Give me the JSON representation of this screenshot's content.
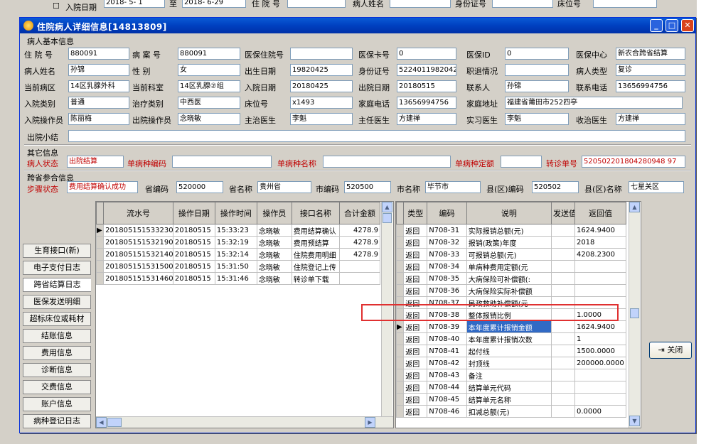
{
  "background": {
    "checkbox_label": "入院日期",
    "date_from": "2018- 5- 1",
    "to_label": "至",
    "date_to": "2018- 6-29",
    "admission_no_label": "住 院 号",
    "patient_name_label": "病人姓名",
    "id_label": "身份证号",
    "bed_label": "床位号"
  },
  "window": {
    "title": "住院病人详细信息[14813809]"
  },
  "sections": {
    "patient": "病人基本信息",
    "other": "其它信息",
    "cross": "跨省参合信息"
  },
  "fields": [
    {
      "label": "住 院 号",
      "value": "880091"
    },
    {
      "label": "病 案 号",
      "value": "880091"
    },
    {
      "label": "医保住院号",
      "value": ""
    },
    {
      "label": "医保卡号",
      "value": "0"
    },
    {
      "label": "医保ID",
      "value": "0"
    },
    {
      "label": "医保中心",
      "value": "新农合跨省结算"
    },
    {
      "label": "病人姓名",
      "value": "孙锦"
    },
    {
      "label": "性    别",
      "value": "女"
    },
    {
      "label": "出生日期",
      "value": "19820425"
    },
    {
      "label": "身份证号",
      "value": "52240119820425"
    },
    {
      "label": "职退情况",
      "value": ""
    },
    {
      "label": "病人类型",
      "value": "复诊"
    },
    {
      "label": "当前病区",
      "value": "14区乳腺外科"
    },
    {
      "label": "当前科室",
      "value": "14区乳腺②组"
    },
    {
      "label": "入院日期",
      "value": "20180425"
    },
    {
      "label": "出院日期",
      "value": "20180515"
    },
    {
      "label": "联系人",
      "value": "孙锦"
    },
    {
      "label": "联系电话",
      "value": "13656994756"
    },
    {
      "label": "入院类别",
      "value": "普通"
    },
    {
      "label": "治疗类别",
      "value": "中西医"
    },
    {
      "label": "床位号",
      "value": "x1493"
    },
    {
      "label": "家庭电话",
      "value": "13656994756"
    },
    {
      "label": "家庭地址",
      "value": "福建省莆田市252四亭"
    },
    {
      "label": "入院操作员",
      "value": "陈丽梅"
    },
    {
      "label": "出院操作员",
      "value": "念晓敏"
    },
    {
      "label": "主治医生",
      "value": "李魁"
    },
    {
      "label": "主任医生",
      "value": "方建禅"
    },
    {
      "label": "实习医生",
      "value": "李魁"
    },
    {
      "label": "收治医生",
      "value": "方建禅"
    }
  ],
  "discharge_summary": {
    "label": "出院小结",
    "value": ""
  },
  "other": {
    "status_label": "病人状态",
    "status_value": "出院结算",
    "disease_code_label": "单病种编码",
    "disease_code_value": "",
    "disease_name_label": "单病种名称",
    "disease_name_value": "",
    "disease_fixed_label": "单病种定额",
    "disease_fixed_value": "",
    "referral_label": "转诊单号",
    "referral_value": "520502201804280948 97"
  },
  "cross": {
    "step_label": "步骤状态",
    "step_value": "费用结算确认成功",
    "prov_code_label": "省编码",
    "prov_code_value": "520000",
    "prov_name_label": "省名称",
    "prov_name_value": "贵州省",
    "city_code_label": "市编码",
    "city_code_value": "520500",
    "city_name_label": "市名称",
    "city_name_value": "毕节市",
    "county_code_label": "县(区)编码",
    "county_code_value": "520502",
    "county_name_label": "县(区)名称",
    "county_name_value": "七星关区"
  },
  "tabs": [
    "生育接口(新)",
    "电子支付日志",
    "跨省结算日志",
    "医保发送明细",
    "超标床位或耗材",
    "结账信息",
    "费用信息",
    "诊断信息",
    "交费信息",
    "账户信息",
    "病种登记日志"
  ],
  "active_tab": "跨省结算日志",
  "log_table": {
    "headers": [
      "流水号",
      "操作日期",
      "操作时间",
      "操作员",
      "接口名称",
      "合计金额"
    ],
    "rows": [
      [
        "20180515153323030",
        "20180515",
        "15:33:23",
        "念晓敏",
        "费用结算确认",
        "4278.9"
      ],
      [
        "20180515153219030",
        "20180515",
        "15:32:19",
        "念晓敏",
        "费用预结算",
        "4278.9"
      ],
      [
        "20180515153214030",
        "20180515",
        "15:32:14",
        "念晓敏",
        "住院费用明细",
        "4278.9"
      ],
      [
        "20180515153150030",
        "20180515",
        "15:31:50",
        "念晓敏",
        "住院登记上传",
        ""
      ],
      [
        "20180515153146030",
        "20180515",
        "15:31:46",
        "念晓敏",
        "转诊单下载",
        ""
      ]
    ]
  },
  "detail_table": {
    "headers": [
      "类型",
      "编码",
      "说明",
      "发送值",
      "返回值"
    ],
    "rows": [
      [
        "返回",
        "N708-31",
        "实际报销总额(元)",
        "",
        "1624.9400"
      ],
      [
        "返回",
        "N708-32",
        "报销(政策)年度",
        "",
        "2018"
      ],
      [
        "返回",
        "N708-33",
        "可报销总额(元)",
        "",
        "4208.2300"
      ],
      [
        "返回",
        "N708-34",
        "单病种费用定额(元",
        "",
        ""
      ],
      [
        "返回",
        "N708-35",
        "大病保险可补偿额(:",
        "",
        ""
      ],
      [
        "返回",
        "N708-36",
        "大病保险实际补偿额",
        "",
        ""
      ],
      [
        "返回",
        "N708-37",
        "民政救助补偿额(元",
        "",
        ""
      ],
      [
        "返回",
        "N708-38",
        "整体报销比例",
        "",
        "1.0000"
      ],
      [
        "返回",
        "N708-39",
        "本年度累计报销金额",
        "",
        "1624.9400"
      ],
      [
        "返回",
        "N708-40",
        "本年度累计报销次数",
        "",
        "1"
      ],
      [
        "返回",
        "N708-41",
        "起付线",
        "",
        "1500.0000"
      ],
      [
        "返回",
        "N708-42",
        "封顶线",
        "",
        "200000.0000"
      ],
      [
        "返回",
        "N708-43",
        "备注",
        "",
        ""
      ],
      [
        "返回",
        "N708-44",
        "结算单元代码",
        "",
        ""
      ],
      [
        "返回",
        "N708-45",
        "结算单元名称",
        "",
        ""
      ],
      [
        "返回",
        "N708-46",
        "扣减总额(元)",
        "",
        "0.0000"
      ]
    ],
    "selected_index": 8
  },
  "close_button": "关闭"
}
